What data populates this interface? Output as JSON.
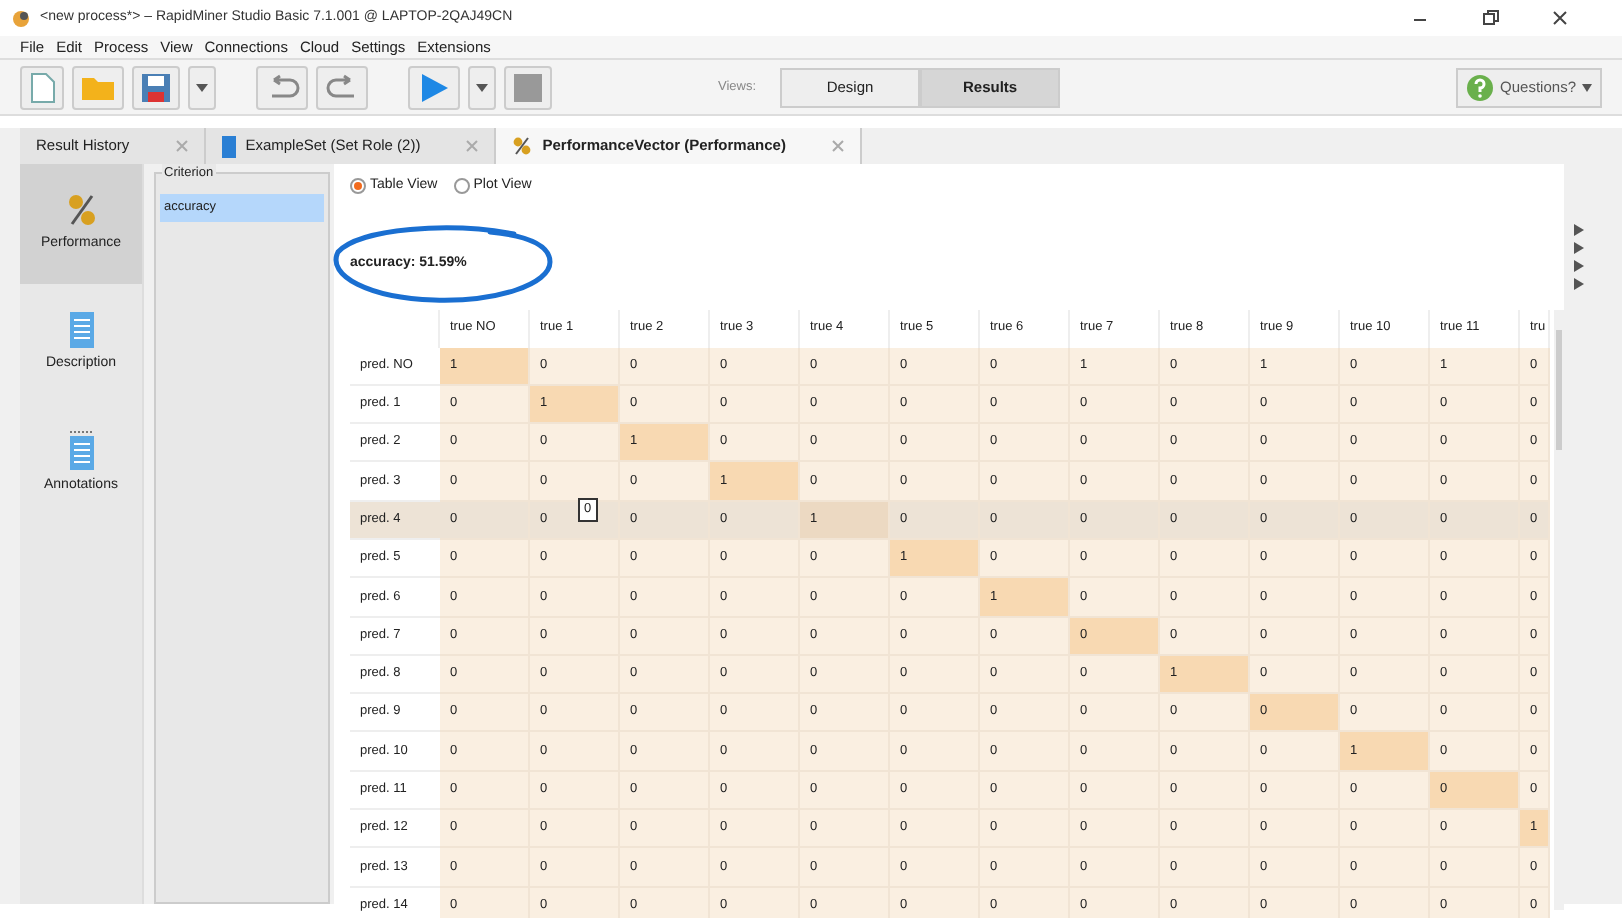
{
  "window": {
    "title": "<new process*> – RapidMiner Studio Basic 7.1.001 @ LAPTOP-2QAJ49CN"
  },
  "menu": [
    "File",
    "Edit",
    "Process",
    "View",
    "Connections",
    "Cloud",
    "Settings",
    "Extensions"
  ],
  "views": {
    "label": "Views:",
    "items": [
      {
        "label": "Design",
        "selected": false
      },
      {
        "label": "Results",
        "selected": true
      }
    ]
  },
  "help_button": {
    "label": "Questions?"
  },
  "tabs": [
    {
      "label": "Result History",
      "selected": false,
      "kind": "plain"
    },
    {
      "label": "ExampleSet (Set Role (2))",
      "selected": false,
      "kind": "table"
    },
    {
      "label": "PerformanceVector (Performance)",
      "selected": true,
      "kind": "performance"
    }
  ],
  "sidebar": {
    "items": [
      {
        "label": "Performance",
        "selected": true,
        "kind": "percent"
      },
      {
        "label": "Description",
        "selected": false,
        "kind": "document"
      },
      {
        "label": "Annotations",
        "selected": false,
        "kind": "notes"
      }
    ]
  },
  "criterion": {
    "title": "Criterion",
    "items": [
      {
        "label": "accuracy",
        "selected": true
      }
    ]
  },
  "view_options": [
    {
      "label": "Table View",
      "checked": true
    },
    {
      "label": "Plot View",
      "checked": false
    }
  ],
  "accuracy": "accuracy: 51.59%",
  "tooltip": "0",
  "table": {
    "columns": [
      "true NO",
      "true 1",
      "true 2",
      "true 3",
      "true 4",
      "true 5",
      "true 6",
      "true 7",
      "true 8",
      "true 9",
      "true 10",
      "true 11",
      "tru"
    ],
    "rows": [
      {
        "label": "pred. NO",
        "selected": false,
        "cells": [
          "1",
          "0",
          "0",
          "0",
          "0",
          "0",
          "0",
          "1",
          "0",
          "1",
          "0",
          "1",
          "0"
        ],
        "highlighted": [
          true,
          false,
          false,
          false,
          false,
          false,
          false,
          false,
          false,
          false,
          false,
          false,
          false
        ]
      },
      {
        "label": "pred. 1",
        "selected": false,
        "cells": [
          "0",
          "1",
          "0",
          "0",
          "0",
          "0",
          "0",
          "0",
          "0",
          "0",
          "0",
          "0",
          "0"
        ],
        "highlighted": [
          false,
          true,
          false,
          false,
          false,
          false,
          false,
          false,
          false,
          false,
          false,
          false,
          false
        ]
      },
      {
        "label": "pred. 2",
        "selected": false,
        "cells": [
          "0",
          "0",
          "1",
          "0",
          "0",
          "0",
          "0",
          "0",
          "0",
          "0",
          "0",
          "0",
          "0"
        ],
        "highlighted": [
          false,
          false,
          true,
          false,
          false,
          false,
          false,
          false,
          false,
          false,
          false,
          false,
          false
        ]
      },
      {
        "label": "pred. 3",
        "selected": false,
        "cells": [
          "0",
          "0",
          "0",
          "1",
          "0",
          "0",
          "0",
          "0",
          "0",
          "0",
          "0",
          "0",
          "0"
        ],
        "highlighted": [
          false,
          false,
          false,
          true,
          false,
          false,
          false,
          false,
          false,
          false,
          false,
          false,
          false
        ]
      },
      {
        "label": "pred. 4",
        "selected": true,
        "cells": [
          "0",
          "0",
          "0",
          "0",
          "1",
          "0",
          "0",
          "0",
          "0",
          "0",
          "0",
          "0",
          "0"
        ],
        "highlighted": [
          false,
          false,
          false,
          false,
          true,
          false,
          false,
          false,
          false,
          false,
          false,
          false,
          false
        ]
      },
      {
        "label": "pred. 5",
        "selected": false,
        "cells": [
          "0",
          "0",
          "0",
          "0",
          "0",
          "1",
          "0",
          "0",
          "0",
          "0",
          "0",
          "0",
          "0"
        ],
        "highlighted": [
          false,
          false,
          false,
          false,
          false,
          true,
          false,
          false,
          false,
          false,
          false,
          false,
          false
        ]
      },
      {
        "label": "pred. 6",
        "selected": false,
        "cells": [
          "0",
          "0",
          "0",
          "0",
          "0",
          "0",
          "1",
          "0",
          "0",
          "0",
          "0",
          "0",
          "0"
        ],
        "highlighted": [
          false,
          false,
          false,
          false,
          false,
          false,
          true,
          false,
          false,
          false,
          false,
          false,
          false
        ]
      },
      {
        "label": "pred. 7",
        "selected": false,
        "cells": [
          "0",
          "0",
          "0",
          "0",
          "0",
          "0",
          "0",
          "0",
          "0",
          "0",
          "0",
          "0",
          "0"
        ],
        "highlighted": [
          false,
          false,
          false,
          false,
          false,
          false,
          false,
          true,
          false,
          false,
          false,
          false,
          false
        ]
      },
      {
        "label": "pred. 8",
        "selected": false,
        "cells": [
          "0",
          "0",
          "0",
          "0",
          "0",
          "0",
          "0",
          "0",
          "1",
          "0",
          "0",
          "0",
          "0"
        ],
        "highlighted": [
          false,
          false,
          false,
          false,
          false,
          false,
          false,
          false,
          true,
          false,
          false,
          false,
          false
        ]
      },
      {
        "label": "pred. 9",
        "selected": false,
        "cells": [
          "0",
          "0",
          "0",
          "0",
          "0",
          "0",
          "0",
          "0",
          "0",
          "0",
          "0",
          "0",
          "0"
        ],
        "highlighted": [
          false,
          false,
          false,
          false,
          false,
          false,
          false,
          false,
          false,
          true,
          false,
          false,
          false
        ]
      },
      {
        "label": "pred. 10",
        "selected": false,
        "cells": [
          "0",
          "0",
          "0",
          "0",
          "0",
          "0",
          "0",
          "0",
          "0",
          "0",
          "1",
          "0",
          "0"
        ],
        "highlighted": [
          false,
          false,
          false,
          false,
          false,
          false,
          false,
          false,
          false,
          false,
          true,
          false,
          false
        ]
      },
      {
        "label": "pred. 11",
        "selected": false,
        "cells": [
          "0",
          "0",
          "0",
          "0",
          "0",
          "0",
          "0",
          "0",
          "0",
          "0",
          "0",
          "0",
          "0"
        ],
        "highlighted": [
          false,
          false,
          false,
          false,
          false,
          false,
          false,
          false,
          false,
          false,
          false,
          true,
          false
        ]
      },
      {
        "label": "pred. 12",
        "selected": false,
        "cells": [
          "0",
          "0",
          "0",
          "0",
          "0",
          "0",
          "0",
          "0",
          "0",
          "0",
          "0",
          "0",
          "1"
        ],
        "highlighted": [
          false,
          false,
          false,
          false,
          false,
          false,
          false,
          false,
          false,
          false,
          false,
          false,
          true
        ]
      },
      {
        "label": "pred. 13",
        "selected": false,
        "cells": [
          "0",
          "0",
          "0",
          "0",
          "0",
          "0",
          "0",
          "0",
          "0",
          "0",
          "0",
          "0",
          "0"
        ],
        "highlighted": [
          false,
          false,
          false,
          false,
          false,
          false,
          false,
          false,
          false,
          false,
          false,
          false,
          false
        ]
      },
      {
        "label": "pred. 14",
        "selected": false,
        "cells": [
          "0",
          "0",
          "0",
          "0",
          "0",
          "0",
          "0",
          "0",
          "0",
          "0",
          "0",
          "0",
          "0"
        ],
        "highlighted": [
          false,
          false,
          false,
          false,
          false,
          false,
          false,
          false,
          false,
          false,
          false,
          false,
          false
        ]
      }
    ]
  }
}
